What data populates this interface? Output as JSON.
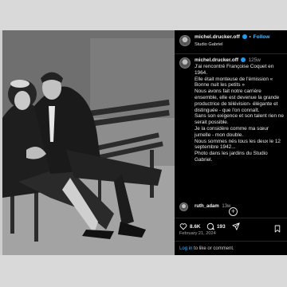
{
  "header": {
    "username": "michel.drucker.off",
    "follow_label": "Follow",
    "location": "Studio Gabriel"
  },
  "caption": {
    "username": "michel.drucker.off",
    "time": "125w",
    "text": "J'ai rencontré Françoise Coquet en 1964.\nElle était monteuse de l'émission « Bonne nuit les petits »\nNous avons fait notre carrière ensemble, elle est devenue la grande productrice de télévision- élégante et distinguée - que l'on connaît.\nSans son exigence et son talent rien ne serait possible.\nJe la considère comme ma sœur jumelle - mon double.\nNous sommes nés tous les deux le 12 septembre 1942...\nPhoto dans les jardins du Studio Gabriel."
  },
  "reply": {
    "username": "ruth_adam",
    "time": "13w"
  },
  "actions": {
    "likes": "8.6K",
    "comments": "193"
  },
  "date": "February 21, 2024",
  "footer": {
    "login_label": "Log in",
    "rest": " to like or comment."
  },
  "icons": [
    "verified-icon",
    "heart-icon",
    "comment-icon",
    "share-icon",
    "bookmark-icon",
    "plus-circle-icon"
  ],
  "colors": {
    "panel_background": "#000000",
    "link_blue": "#4cb5f9",
    "verified_blue": "#1d9bf0"
  }
}
